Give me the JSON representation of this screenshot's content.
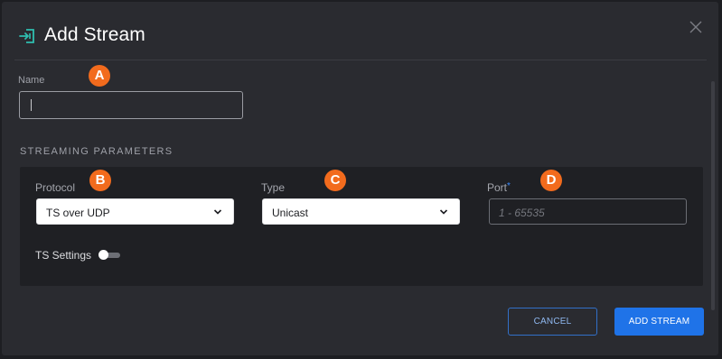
{
  "dialog": {
    "title": "Add Stream",
    "title_icon": "stream-input-icon",
    "close_icon": "close-icon"
  },
  "name_field": {
    "label": "Name",
    "value": "",
    "badge": "A"
  },
  "streaming": {
    "section_title": "STREAMING PARAMETERS",
    "protocol": {
      "label": "Protocol",
      "value": "TS over UDP",
      "badge": "B"
    },
    "type": {
      "label": "Type",
      "value": "Unicast",
      "badge": "C"
    },
    "port": {
      "label": "Port",
      "required_mark": "*",
      "placeholder": "1 - 65535",
      "badge": "D"
    },
    "ts_settings": {
      "label": "TS Settings",
      "enabled": false
    }
  },
  "actions": {
    "cancel_label": "CANCEL",
    "add_label": "ADD STREAM"
  },
  "colors": {
    "accent": "#1f73e8",
    "badge": "#f26b1d",
    "icon_teal": "#2fbfb0"
  }
}
